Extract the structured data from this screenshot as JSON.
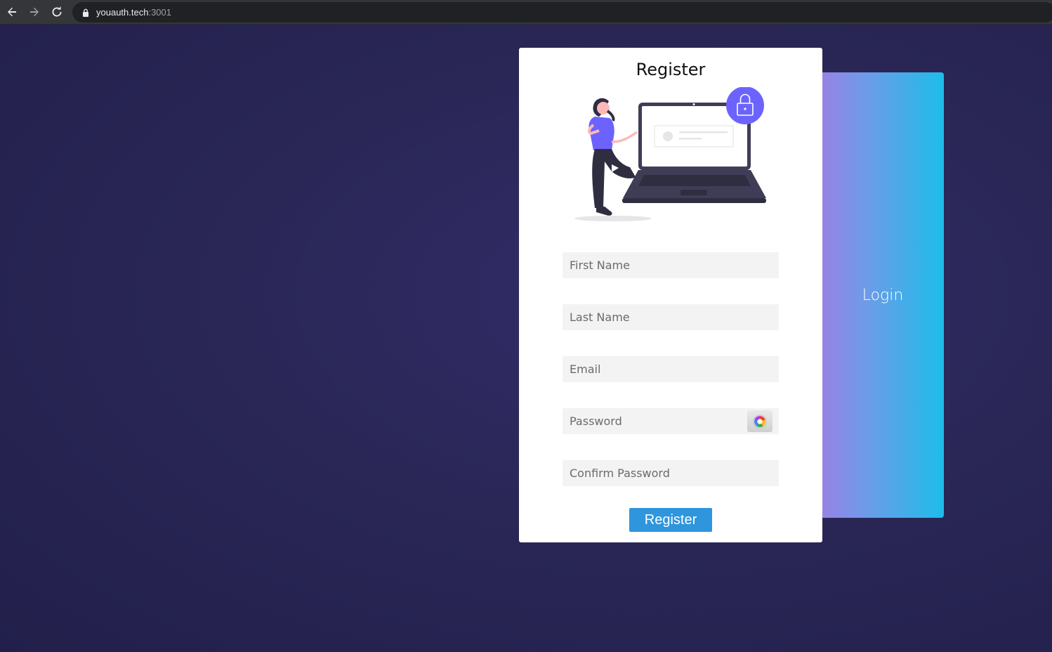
{
  "browser": {
    "url_host": "youauth.tech",
    "url_port": ":3001"
  },
  "register": {
    "title": "Register",
    "fields": {
      "first_name": "First Name",
      "last_name": "Last Name",
      "email": "Email",
      "password": "Password",
      "confirm_password": "Confirm Password"
    },
    "button_label": "Register"
  },
  "login_panel": {
    "label": "Login"
  },
  "colors": {
    "accent_purple": "#6c63ff",
    "button_blue": "#2f95dd",
    "background": "#2a2757"
  }
}
